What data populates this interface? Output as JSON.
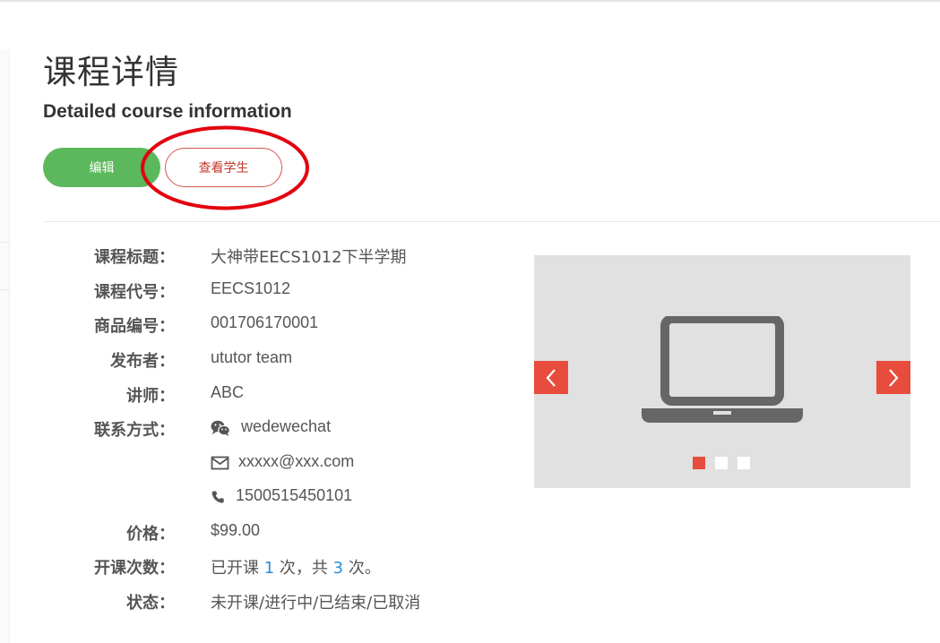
{
  "header": {
    "title": "课程详情",
    "subtitle": "Detailed course information"
  },
  "actions": {
    "edit_label": "编辑",
    "view_students_label": "查看学生"
  },
  "details": [
    {
      "label": "课程标题：",
      "value": "大神带EECS1012下半学期"
    },
    {
      "label": "课程代号：",
      "value": "EECS1012"
    },
    {
      "label": "商品编号：",
      "value": "001706170001"
    },
    {
      "label": "发布者：",
      "value": "ututor team"
    },
    {
      "label": "讲师：",
      "value": "ABC"
    },
    {
      "label": "联系方式：",
      "value": "wedewechat"
    },
    {
      "label": "",
      "value": "xxxxx@xxx.com"
    },
    {
      "label": "",
      "value": "1500515450101"
    },
    {
      "label": "价格：",
      "value": "$99.00"
    },
    {
      "label": "开课次数：",
      "value_prefix": "已开课 ",
      "count_done": "1",
      "value_mid": " 次，共 ",
      "count_total": "3",
      "value_suffix": " 次。"
    },
    {
      "label": "状态：",
      "value": "未开课/进行中/已结束/已取消"
    }
  ],
  "contact_icons": [
    "wechat-icon",
    "envelope-icon",
    "phone-icon"
  ],
  "carousel": {
    "image_icon": "laptop-icon",
    "slide_count": 3,
    "active_slide": 1
  },
  "colors": {
    "edit_button": "#5cb85c",
    "students_button_border": "#d9534f",
    "carousel_accent": "#e74c3c",
    "link_number": "#2b8cd6",
    "highlight_ring": "#e3000f"
  }
}
